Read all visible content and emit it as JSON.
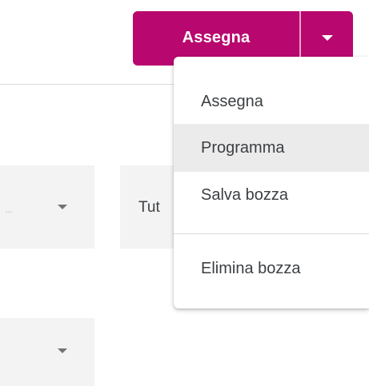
{
  "split_button": {
    "label": "Assegna",
    "color": "#b8086f",
    "arrow_icon": "chevron-down-icon"
  },
  "filters": [
    {
      "value": "...",
      "icon": "dropdown-arrow-icon"
    },
    {
      "value": "Tut"
    },
    {
      "value": "",
      "icon": "dropdown-arrow-icon"
    }
  ],
  "dropdown_menu": {
    "items": [
      {
        "label": "Assegna"
      },
      {
        "label": "Programma",
        "hovered": true
      },
      {
        "label": "Salva bozza"
      },
      {
        "label": "Elimina bozza"
      }
    ]
  }
}
